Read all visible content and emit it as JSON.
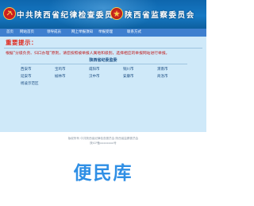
{
  "header": {
    "title_left": "中共陕西省纪律检查委员会",
    "title_right": "陕西省监察委员会",
    "colors": {
      "banner": "#1679c4",
      "nav": "#3e7fcf",
      "content_bg": "#cfe9f9",
      "emblem_red": "#cc1f1f",
      "emblem_gold": "#f2c94c"
    }
  },
  "nav": {
    "items": [
      "首页",
      "网站首页",
      "领导成员",
      "网上举报须知",
      "举报受理",
      "联系方式"
    ]
  },
  "notice": {
    "title": "重要提示：",
    "text": "根据“分级负责、归口办理”原则，请您按照被举报人属地和级别，选择相应的举报网站进行举报。"
  },
  "section": {
    "title": "陕西省纪委监委"
  },
  "cities": [
    "西安市",
    "宝鸡市",
    "咸阳市",
    "铜川市",
    "渭南市",
    "延安市",
    "榆林市",
    "汉中市",
    "安康市",
    "商洛市",
    "杨凌示范区"
  ],
  "footer": {
    "line1": "版权所有 中共陕西省纪律检查委员会 陕西省监察委员会",
    "line2": "陕ICP备xxxxxxxx号"
  },
  "watermark": "便民库"
}
